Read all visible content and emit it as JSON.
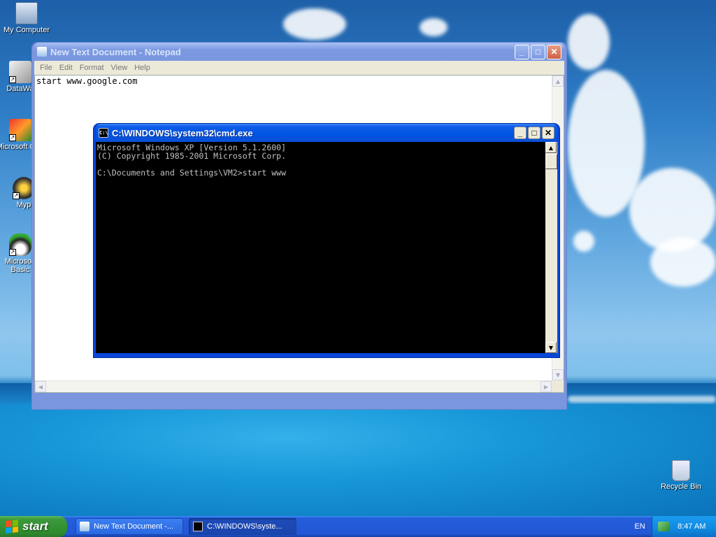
{
  "desktop": {
    "icons": [
      {
        "label": "My Computer",
        "icon": "my-computer-icon"
      },
      {
        "label": "DataWa",
        "icon": "shortcut-app-icon"
      },
      {
        "label": "Microsoft C++",
        "icon": "visual-cpp-icon"
      },
      {
        "label": "Myp",
        "icon": "shortcut-app-icon"
      },
      {
        "label": "Microsoft Basic",
        "icon": "visual-basic-icon"
      }
    ],
    "recycle_bin": {
      "label": "Recycle Bin",
      "icon": "recycle-bin-icon"
    }
  },
  "notepad": {
    "title": "New Text Document - Notepad",
    "menu": [
      "File",
      "Edit",
      "Format",
      "View",
      "Help"
    ],
    "content": "start www.google.com",
    "buttons": {
      "minimize": "_",
      "maximize": "□",
      "close": "✕"
    }
  },
  "cmd": {
    "title": "C:\\WINDOWS\\system32\\cmd.exe",
    "icon_label": "C:\\",
    "lines": [
      "Microsoft Windows XP [Version 5.1.2600]",
      "(C) Copyright 1985-2001 Microsoft Corp.",
      "",
      "C:\\Documents and Settings\\VM2>start www"
    ],
    "buttons": {
      "minimize": "_",
      "maximize": "□",
      "close": "✕"
    }
  },
  "taskbar": {
    "start_label": "start",
    "items": [
      {
        "label": "New Text Document -...",
        "icon": "notepad-icon"
      },
      {
        "label": "C:\\WINDOWS\\syste...",
        "icon": "cmd-icon"
      }
    ],
    "language": "EN",
    "clock": "8:47 AM"
  },
  "colors": {
    "titlebar_active": "#0054e3",
    "titlebar_inactive": "#7a96df",
    "taskbar": "#245edb",
    "start_button": "#3c9a3c",
    "tray": "#108ae0"
  }
}
